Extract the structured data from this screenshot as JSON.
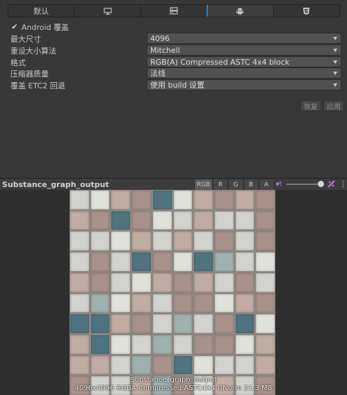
{
  "tabs": {
    "default": "默认",
    "standalone_icon": "monitor-icon",
    "server_icon": "server-icon",
    "android_icon": "android-icon",
    "webgl_icon": "html5-icon"
  },
  "override": {
    "checked": true,
    "mark": "✔",
    "label": "Android 覆盖"
  },
  "settings": [
    {
      "label": "最大尺寸",
      "value": "4096"
    },
    {
      "label": "重设大小算法",
      "value": "Mitchell"
    },
    {
      "label": "格式",
      "value": "RGB(A) Compressed ASTC 4x4 block"
    },
    {
      "label": "压缩器质量",
      "value": "法线"
    },
    {
      "label": "覆盖 ETC2 回退",
      "value": "使用 build 设置"
    }
  ],
  "buttons": {
    "revert": "恢复",
    "apply": "应用"
  },
  "preview": {
    "title": "Substance_graph_output",
    "channels": [
      "RGB",
      "R",
      "G",
      "B",
      "A"
    ],
    "active_channel": "RGB",
    "mip_slider_value": 1.0,
    "info_name": "Substance_graph_output",
    "info_details": "4096x4096  RGBA Compressed ASTC4X4 UNorm   21.3 MB"
  },
  "colors": {
    "accent": "#3a79bb",
    "tile_palette": {
      "a": "#d2d2ce",
      "b": "#c0aca3",
      "c": "#a9928c",
      "d": "#4f7480",
      "e": "#a0b0ae",
      "f": "#e1e1db"
    }
  },
  "texture_pattern": [
    "afbcdfbcbc",
    "bcdcfabaac",
    "aafbabacac",
    "acadcfdeaf",
    "bcafbcbaca",
    "aefbaccfbc",
    "ddbcaeacdf",
    "bdfaeaccfb",
    "bbaecdfaab",
    "caabecfbac"
  ]
}
